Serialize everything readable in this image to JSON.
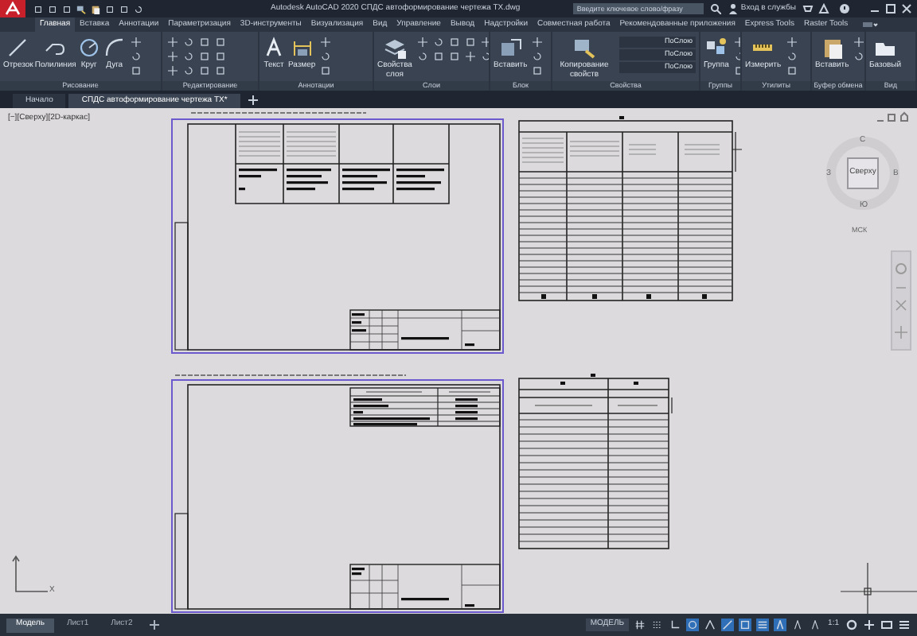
{
  "window": {
    "title": "Autodesk AutoCAD 2020   СПДС автоформирование чертежа TX.dwg",
    "search": {
      "placeholder": "Введите ключевое слово/фразу"
    },
    "sign_in": "Вход в службы"
  },
  "ribbon_tabs": [
    {
      "label": "Главная",
      "selected": true
    },
    {
      "label": "Вставка",
      "selected": false
    },
    {
      "label": "Аннотации",
      "selected": false
    },
    {
      "label": "Параметризация",
      "selected": false
    },
    {
      "label": "3D-инструменты",
      "selected": false
    },
    {
      "label": "Визуализация",
      "selected": false
    },
    {
      "label": "Вид",
      "selected": false
    },
    {
      "label": "Управление",
      "selected": false
    },
    {
      "label": "Вывод",
      "selected": false
    },
    {
      "label": "Надстройки",
      "selected": false
    },
    {
      "label": "Совместная работа",
      "selected": false
    },
    {
      "label": "Рекомендованные приложения",
      "selected": false
    },
    {
      "label": "Express Tools",
      "selected": false
    },
    {
      "label": "Raster Tools",
      "selected": false
    }
  ],
  "ribbon_panels": [
    {
      "title": "Рисование",
      "tools": [
        {
          "label": "Отрезок"
        },
        {
          "label": "Полилиния"
        },
        {
          "label": "Круг"
        },
        {
          "label": "Дуга"
        }
      ]
    },
    {
      "title": "Редактирование"
    },
    {
      "title": "Аннотации",
      "tools": [
        {
          "label": "Текст"
        },
        {
          "label": "Размер"
        }
      ]
    },
    {
      "title": "Слои",
      "tools": [
        {
          "label": "Свойства слоя"
        }
      ]
    },
    {
      "title": "Блок",
      "tools": [
        {
          "label": "Вставить"
        }
      ]
    },
    {
      "title": "Свойства",
      "tools": [
        {
          "label": "Копирование свойств"
        }
      ],
      "dropdowns": [
        {
          "value": "ПоСлою"
        },
        {
          "value": "ПоСлою"
        },
        {
          "value": "ПоСлою"
        }
      ]
    },
    {
      "title": "Группы",
      "tools": [
        {
          "label": "Группа"
        }
      ]
    },
    {
      "title": "Утилиты",
      "tools": [
        {
          "label": "Измерить"
        }
      ]
    },
    {
      "title": "Буфер обмена",
      "tools": [
        {
          "label": "Вставить"
        }
      ]
    },
    {
      "title": "Вид",
      "tools": [
        {
          "label": "Базовый"
        }
      ]
    }
  ],
  "document_tabs": [
    {
      "label": "Начало",
      "selected": false
    },
    {
      "label": "СПДС автоформирование чертежа TX*",
      "selected": true
    }
  ],
  "viewport": {
    "label": "[−][Сверху][2D-каркас]",
    "viewcube": {
      "face": "Сверху",
      "north": "С",
      "south": "Ю",
      "west": "З",
      "east": "В",
      "ucs": "МСК"
    },
    "ucs_axis": "X"
  },
  "layout_tabs": [
    {
      "label": "Модель",
      "selected": true
    },
    {
      "label": "Лист1",
      "selected": false
    },
    {
      "label": "Лист2",
      "selected": false
    }
  ],
  "status_bar": {
    "space": "МОДЕЛЬ",
    "scale": "1:1",
    "toggles": [
      {
        "on": false
      },
      {
        "on": false
      },
      {
        "on": false
      },
      {
        "on": true
      },
      {
        "on": false
      },
      {
        "on": true
      },
      {
        "on": true
      },
      {
        "on": true
      },
      {
        "on": true
      },
      {
        "on": false
      },
      {
        "on": false
      }
    ]
  }
}
